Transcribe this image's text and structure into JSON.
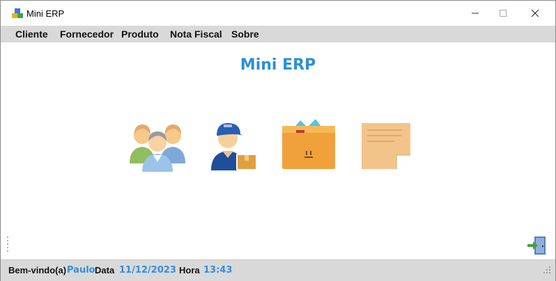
{
  "window": {
    "title": "Mini ERP",
    "minimize_icon": "minimize-icon",
    "maximize_icon": "maximize-icon",
    "close_icon": "close-icon"
  },
  "menu": {
    "items": [
      {
        "label": "Cliente"
      },
      {
        "label": "Fornecedor"
      },
      {
        "label": "Produto"
      },
      {
        "label": "Nota Fiscal"
      },
      {
        "label": "Sobre"
      }
    ]
  },
  "main": {
    "heading": "Mini ERP",
    "tiles": [
      {
        "icon": "customers-group-icon"
      },
      {
        "icon": "delivery-person-icon"
      },
      {
        "icon": "product-box-icon"
      },
      {
        "icon": "invoice-note-icon"
      }
    ],
    "exit_icon": "exit-door-icon"
  },
  "status": {
    "welcome_label": "Bem-vindo(a)",
    "user": "Paulo",
    "date_label": "Data",
    "date": "11/12/2023",
    "time_label": "Hora",
    "time": "13:43"
  },
  "colors": {
    "accent": "#2d8fd6",
    "menubar_bg": "#d9d9d9",
    "status_value": "#2f8fe0"
  }
}
